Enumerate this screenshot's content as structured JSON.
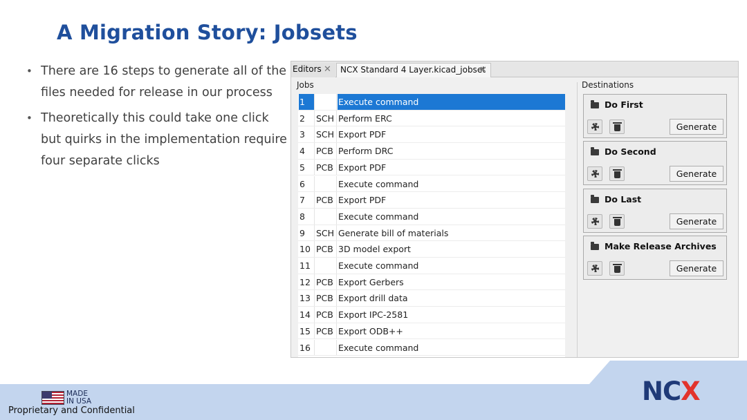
{
  "slide": {
    "title": "A Migration Story: Jobsets",
    "bullets": [
      "There are 16 steps to generate all of the files needed for release in our process",
      "Theoretically this could take one click but quirks in the implementation require four separate clicks"
    ]
  },
  "app": {
    "tabs": [
      {
        "label": "Editors",
        "close": "✕"
      },
      {
        "label": "NCX Standard 4 Layer.kicad_jobset",
        "close": "✕"
      }
    ],
    "jobs_label": "Jobs",
    "jobs": [
      {
        "num": "1",
        "source": "",
        "desc": "Execute command",
        "selected": true
      },
      {
        "num": "2",
        "source": "SCH",
        "desc": "Perform ERC"
      },
      {
        "num": "3",
        "source": "SCH",
        "desc": "Export PDF"
      },
      {
        "num": "4",
        "source": "PCB",
        "desc": "Perform DRC"
      },
      {
        "num": "5",
        "source": "PCB",
        "desc": "Export PDF"
      },
      {
        "num": "6",
        "source": "",
        "desc": "Execute command"
      },
      {
        "num": "7",
        "source": "PCB",
        "desc": "Export PDF"
      },
      {
        "num": "8",
        "source": "",
        "desc": "Execute command"
      },
      {
        "num": "9",
        "source": "SCH",
        "desc": "Generate bill of materials"
      },
      {
        "num": "10",
        "source": "PCB",
        "desc": "3D model export"
      },
      {
        "num": "11",
        "source": "",
        "desc": "Execute command"
      },
      {
        "num": "12",
        "source": "PCB",
        "desc": "Export Gerbers"
      },
      {
        "num": "13",
        "source": "PCB",
        "desc": "Export drill data"
      },
      {
        "num": "14",
        "source": "PCB",
        "desc": "Export IPC-2581"
      },
      {
        "num": "15",
        "source": "PCB",
        "desc": "Export ODB++"
      },
      {
        "num": "16",
        "source": "",
        "desc": "Execute command"
      }
    ],
    "destinations_label": "Destinations",
    "destinations": [
      {
        "name": "Do First",
        "generate_label": "Generate"
      },
      {
        "name": "Do Second",
        "generate_label": "Generate"
      },
      {
        "name": "Do Last",
        "generate_label": "Generate"
      },
      {
        "name": "Make Release Archives",
        "generate_label": "Generate"
      }
    ],
    "selection_color": "#1c78d4"
  },
  "footer": {
    "made_line1": "MADE",
    "made_line2": "IN USA",
    "confidential": "Proprietary and Confidential",
    "logo_left": "NC",
    "logo_right": "X",
    "band_color": "#c3d5ee"
  }
}
